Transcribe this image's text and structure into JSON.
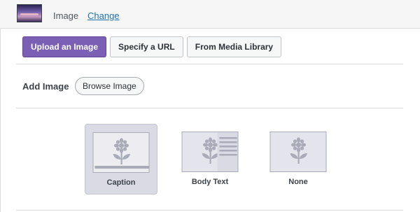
{
  "header": {
    "label": "Image",
    "change_link": "Change",
    "thumbnail": "sunset-photo-thumbnail"
  },
  "source_tabs": [
    {
      "label": "Upload an Image",
      "active": true
    },
    {
      "label": "Specify a URL",
      "active": false
    },
    {
      "label": "From Media Library",
      "active": false
    }
  ],
  "add_image": {
    "label": "Add Image",
    "browse_button": "Browse Image"
  },
  "caption_options": [
    {
      "label": "Caption",
      "selected": true,
      "icon": "image-with-caption-icon"
    },
    {
      "label": "Body Text",
      "selected": false,
      "icon": "image-with-body-text-icon"
    },
    {
      "label": "None",
      "selected": false,
      "icon": "image-only-icon"
    }
  ],
  "colors": {
    "accent": "#7a5fb5",
    "link": "#2271b1",
    "selected_option_bg": "#d9dae3"
  }
}
